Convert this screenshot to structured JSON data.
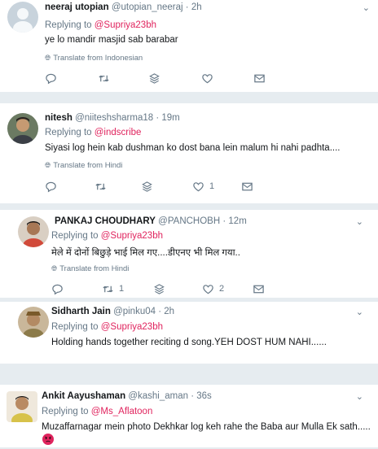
{
  "tweets": [
    {
      "name": "neeraj utopian",
      "handle": "@utopian_neeraj",
      "dot": "·",
      "time": "2h",
      "reply_prefix": "Replying to",
      "reply_to": "@Supriya23bh",
      "text": "ye lo mandir masjid sab barabar",
      "translate": "Translate from Indonesian",
      "replies": "",
      "retweets": "",
      "likes": ""
    },
    {
      "name": "nitesh",
      "handle": "@niiteshsharma18",
      "dot": "·",
      "time": "19m",
      "reply_prefix": "Replying to",
      "reply_to": "@indscribe",
      "text": "Siyasi log hein kab dushman ko dost bana lein malum hi nahi padhta....",
      "translate": "Translate from Hindi",
      "replies": "",
      "retweets": "",
      "likes": "1"
    },
    {
      "name": "PANKAJ CHOUDHARY",
      "handle": "@PANCHOBH",
      "dot": "·",
      "time": "12m",
      "reply_prefix": "Replying to",
      "reply_to": "@Supriya23bh",
      "text": "मेले में दोनों बिछुड़े भाई मिल गए....डीएनए भी मिल गया..",
      "translate": "Translate from Hindi",
      "replies": "",
      "retweets": "1",
      "likes": "2"
    },
    {
      "name": "Sidharth Jain",
      "handle": "@pinku04",
      "dot": "·",
      "time": "2h",
      "reply_prefix": "Replying to",
      "reply_to": "@Supriya23bh",
      "text": "Holding hands together reciting d song.YEH DOST HUM NAHI......",
      "translate": "",
      "replies": "",
      "retweets": "",
      "likes": ""
    },
    {
      "name": "Ankit Aayushaman",
      "handle": "@kashi_aman",
      "dot": "·",
      "time": "36s",
      "reply_prefix": "Replying to",
      "reply_to": "@Ms_Aflatoon",
      "text": "Muzaffarnagar mein photo Dekhkar log keh rahe the Baba aur Mulla Ek sath.....",
      "translate": "",
      "replies": "",
      "retweets": "",
      "likes": ""
    }
  ],
  "icons": {
    "caret": "chevron-down-icon",
    "globe": "globe-icon",
    "reply": "reply-icon",
    "retweet": "retweet-icon",
    "stack": "stack-icon",
    "like": "heart-icon",
    "dm": "envelope-icon",
    "emoji": "angry-face-icon"
  },
  "colors": {
    "mention": "#e0245e",
    "muted": "#657786",
    "text": "#14171a",
    "separator": "#e6ecf0"
  }
}
